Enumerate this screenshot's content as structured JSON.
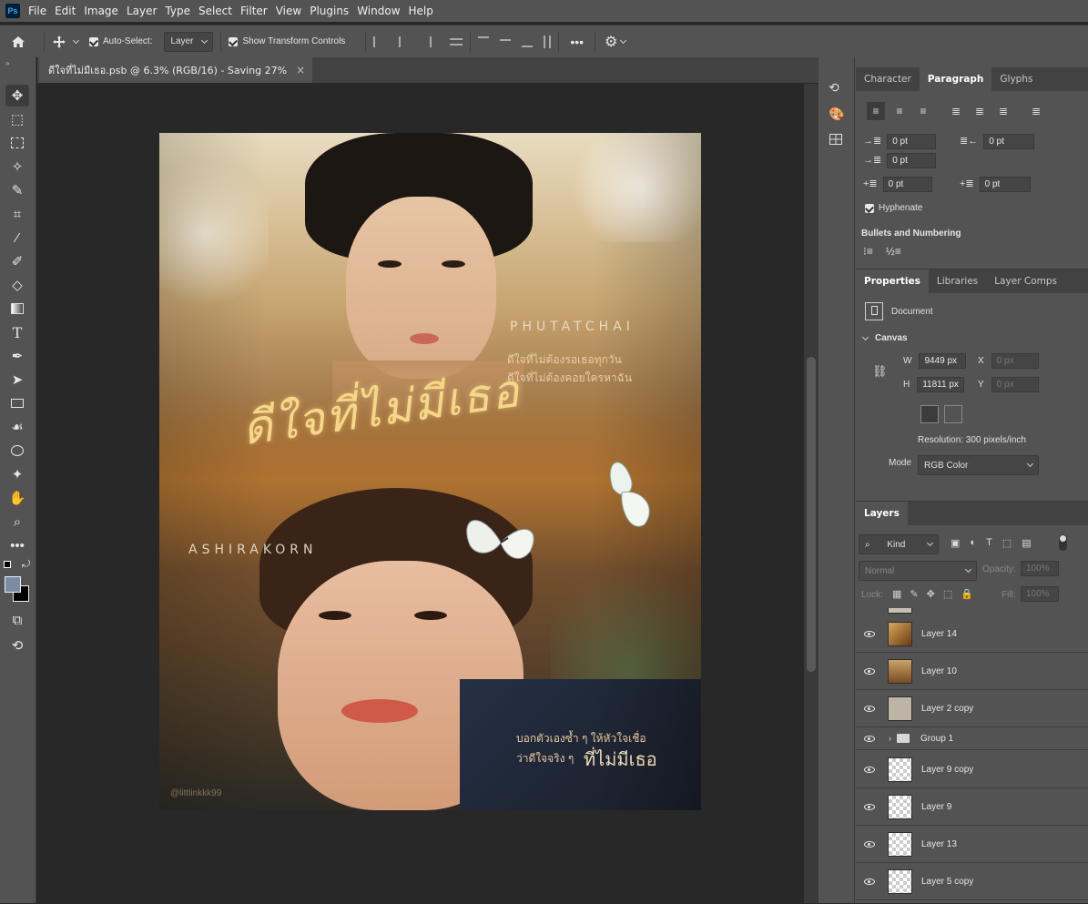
{
  "app": {
    "logo": "Ps"
  },
  "menu": [
    "File",
    "Edit",
    "Image",
    "Layer",
    "Type",
    "Select",
    "Filter",
    "View",
    "Plugins",
    "Window",
    "Help"
  ],
  "options_bar": {
    "auto_select_label": "Auto-Select:",
    "auto_select_value": "Layer",
    "transform_label": "Show Transform Controls",
    "more_label": "•••"
  },
  "document_tab": {
    "title": "ดีใจที่ไม่มีเธอ.psb @ 6.3% (RGB/16) - Saving 27%",
    "close": "×"
  },
  "artwork": {
    "name_top": "PHUTATCHAI",
    "thai_top_1": "ดีใจที่ไม่ต้องรอเธอทุกวัน",
    "thai_top_2": "ดีใจที่ไม่ต้องคอยใครหาฉัน",
    "script_title": "ดีใจที่ไม่มีเธอ",
    "name_mid": "ASHIRAKORN",
    "thai_bottom_1": "บอกตัวเองซ้ำ ๆ ให้หัวใจเชื่อ",
    "thai_bottom_2": "ว่าดีใจจริง ๆ",
    "thai_bottom_3": "ที่ไม่มีเธอ",
    "credit": "@littlinkkk99"
  },
  "paragraph_panel": {
    "tabs": [
      "Character",
      "Paragraph",
      "Glyphs"
    ],
    "active_tab": "Paragraph",
    "indent_left": "0 pt",
    "indent_right": "0 pt",
    "indent_first": "0 pt",
    "space_before": "0 pt",
    "space_after": "0 pt",
    "hyphenate": "Hyphenate",
    "bullets_title": "Bullets and Numbering"
  },
  "properties_panel": {
    "tabs": [
      "Properties",
      "Libraries",
      "Layer Comps"
    ],
    "doc_label": "Document",
    "section": "Canvas",
    "w_label": "W",
    "w_value": "9449 px",
    "h_label": "H",
    "h_value": "11811 px",
    "x_label": "X",
    "x_value": "0 px",
    "y_label": "Y",
    "y_value": "0 px",
    "resolution": "Resolution: 300 pixels/inch",
    "mode_label": "Mode",
    "mode_value": "RGB Color"
  },
  "layers_panel": {
    "tab": "Layers",
    "filter": "Kind",
    "blend": "Normal",
    "opacity_label": "Opacity:",
    "opacity_value": "100%",
    "lock_label": "Lock:",
    "fill_label": "Fill:",
    "fill_value": "100%",
    "layers": [
      {
        "name": "Layer 14",
        "thumb": "#8a5a22"
      },
      {
        "name": "Layer 10",
        "thumb": "#a07040"
      },
      {
        "name": "Layer 2 copy",
        "thumb": "#b8b0a4"
      },
      {
        "name": "Group 1",
        "thumb": "folder"
      },
      {
        "name": "Layer 9 copy",
        "thumb": "checker"
      },
      {
        "name": "Layer 9",
        "thumb": "checker"
      },
      {
        "name": "Layer 13",
        "thumb": "checker"
      },
      {
        "name": "Layer 5 copy",
        "thumb": "checker"
      }
    ]
  }
}
